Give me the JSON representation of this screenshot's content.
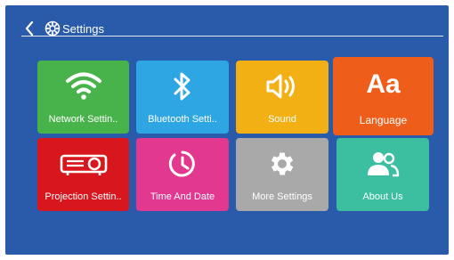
{
  "header": {
    "back_icon": "chevron-left-icon",
    "title_icon": "gear-icon",
    "title": "Settings"
  },
  "tiles": [
    {
      "label": "Network Settin..",
      "icon": "wifi-icon",
      "color": "#49b34b"
    },
    {
      "label": "Bluetooth Setti..",
      "icon": "bluetooth-icon",
      "color": "#2ea6e4"
    },
    {
      "label": "Sound",
      "icon": "speaker-icon",
      "color": "#f2b015"
    },
    {
      "label": "Language",
      "icon": "language-aa-icon",
      "color": "#ee5e1a"
    },
    {
      "label": "Projection Settin..",
      "icon": "projector-icon",
      "color": "#d8161d"
    },
    {
      "label": "Time And Date",
      "icon": "clock-icon",
      "color": "#e3388f"
    },
    {
      "label": "More Settings",
      "icon": "gear-icon",
      "color": "#a9a9a9"
    },
    {
      "label": "About Us",
      "icon": "users-icon",
      "color": "#3bbfa0"
    }
  ],
  "language_glyph": "Aa",
  "colors": {
    "background": "#2a5bab",
    "text": "#ffffff"
  }
}
